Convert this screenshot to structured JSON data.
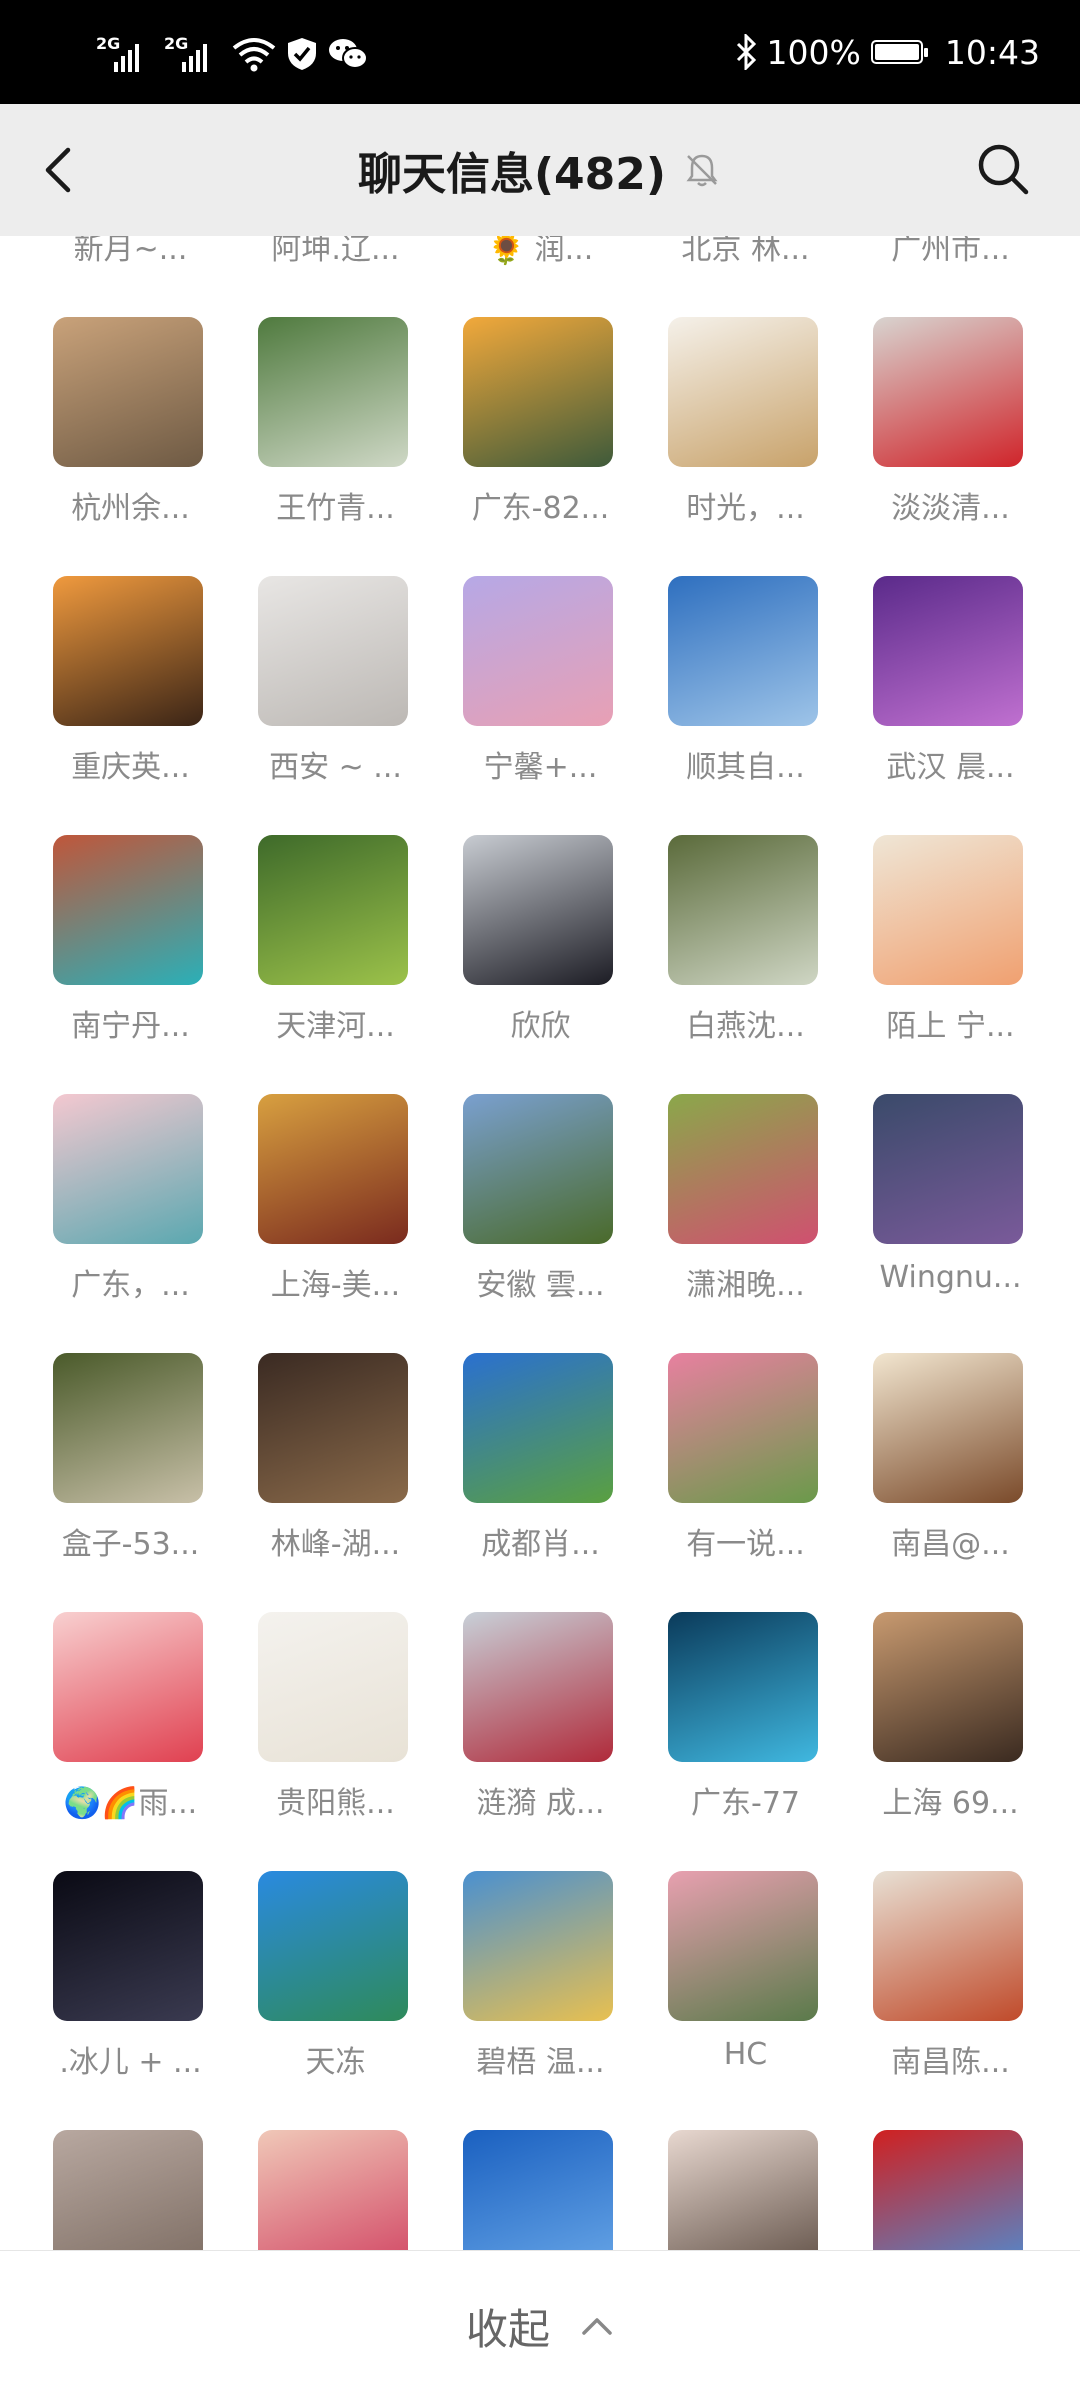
{
  "status_bar": {
    "network_1": "2G",
    "network_2": "2G",
    "battery": "100%",
    "battery_level": 1.0,
    "time": "10:43",
    "icons": [
      "signal-icon",
      "signal-icon",
      "wifi-icon",
      "shield-icon",
      "wechat-icon",
      "bluetooth-icon",
      "battery-icon"
    ]
  },
  "header": {
    "title": "聊天信息(482)",
    "back_icon": "chevron-left-icon",
    "mute_icon": "bell-muted-icon",
    "search_icon": "search-icon"
  },
  "members": [
    {
      "name": "新月~...",
      "colors": [
        "#2c2420",
        "#6b5a4a"
      ]
    },
    {
      "name": "阿坤.辽...",
      "colors": [
        "#3a3632",
        "#8a8076"
      ]
    },
    {
      "name": "🌻 润...",
      "colors": [
        "#6c70c8",
        "#9a9ee0"
      ]
    },
    {
      "name": "北京 林...",
      "colors": [
        "#cfd6de",
        "#8c97a8"
      ]
    },
    {
      "name": "广州市...",
      "colors": [
        "#b02020",
        "#e04a3a"
      ]
    },
    {
      "name": "杭州余...",
      "colors": [
        "#c9a27a",
        "#6e5a44"
      ]
    },
    {
      "name": "王竹青...",
      "colors": [
        "#4f7a3e",
        "#cfd8c6"
      ]
    },
    {
      "name": "广东-82...",
      "colors": [
        "#f2a93b",
        "#3e5a3a"
      ]
    },
    {
      "name": "时光，...",
      "colors": [
        "#f5f1ea",
        "#c8a26a"
      ]
    },
    {
      "name": "淡淡清...",
      "colors": [
        "#d8d4d0",
        "#d0242a"
      ]
    },
    {
      "name": "重庆英...",
      "colors": [
        "#f09a3e",
        "#3a2416"
      ]
    },
    {
      "name": "西安 ~ ...",
      "colors": [
        "#e8e6e4",
        "#bcb8b4"
      ]
    },
    {
      "name": "宁馨+...",
      "colors": [
        "#b6a8e6",
        "#e8a0b4"
      ]
    },
    {
      "name": "顺其自...",
      "colors": [
        "#2e6fbf",
        "#9ec4e8"
      ]
    },
    {
      "name": "武汉 晨...",
      "colors": [
        "#5a2a8a",
        "#c070d0"
      ]
    },
    {
      "name": "南宁丹...",
      "colors": [
        "#c0563a",
        "#2ab0b8"
      ]
    },
    {
      "name": "天津河...",
      "colors": [
        "#3e6a2a",
        "#9cc24a"
      ]
    },
    {
      "name": "欣欣",
      "colors": [
        "#c8ccd2",
        "#1c1c24"
      ]
    },
    {
      "name": "白燕沈...",
      "colors": [
        "#5a6a3a",
        "#cfd6c4"
      ]
    },
    {
      "name": "陌上 宁...",
      "colors": [
        "#efe6d6",
        "#f0a070"
      ]
    },
    {
      "name": "广东，...",
      "colors": [
        "#f4c8d0",
        "#5aa8b0"
      ]
    },
    {
      "name": "上海-美...",
      "colors": [
        "#d8a040",
        "#7a2a1e"
      ]
    },
    {
      "name": "安徽 雲...",
      "colors": [
        "#7aa0d0",
        "#4a6a2a"
      ]
    },
    {
      "name": "潇湘晚...",
      "colors": [
        "#8aa84a",
        "#d05070"
      ]
    },
    {
      "name": "Wingnu...",
      "colors": [
        "#3a4a6a",
        "#7a5a9a"
      ]
    },
    {
      "name": "盒子-53...",
      "colors": [
        "#4a5a2a",
        "#c8c0a8"
      ]
    },
    {
      "name": "林峰-湖...",
      "colors": [
        "#3a2a22",
        "#8a6a4a"
      ]
    },
    {
      "name": "成都肖...",
      "colors": [
        "#2a70d0",
        "#5aa040"
      ]
    },
    {
      "name": "有一说...",
      "colors": [
        "#e880a0",
        "#6a9a4a"
      ]
    },
    {
      "name": "南昌@...",
      "colors": [
        "#f2e6d0",
        "#7a4a2a"
      ]
    },
    {
      "name": "🌍🌈雨...",
      "colors": [
        "#f8d0d0",
        "#e04050"
      ]
    },
    {
      "name": "贵阳熊...",
      "colors": [
        "#f4f2ee",
        "#e8e2d6"
      ]
    },
    {
      "name": "涟漪 成...",
      "colors": [
        "#c8d0d8",
        "#b02a3a"
      ]
    },
    {
      "name": "广东-77",
      "colors": [
        "#0a3a5a",
        "#40b8e0"
      ]
    },
    {
      "name": "上海 69...",
      "colors": [
        "#c89a70",
        "#3a2a20"
      ]
    },
    {
      "name": ".冰儿 + ...",
      "colors": [
        "#0a0a14",
        "#3a3a50"
      ]
    },
    {
      "name": "天冻",
      "colors": [
        "#2a8ae0",
        "#2e8a5a"
      ]
    },
    {
      "name": "碧梧 温...",
      "colors": [
        "#4a90d0",
        "#e8c050"
      ]
    },
    {
      "name": "HC",
      "colors": [
        "#e8a0b0",
        "#5a7a4a"
      ]
    },
    {
      "name": "南昌陈...",
      "colors": [
        "#e8e0d4",
        "#c04a2a"
      ]
    },
    {
      "name": "",
      "colors": [
        "#b8a8a0",
        "#7a6a60"
      ]
    },
    {
      "name": "",
      "colors": [
        "#f0c8b8",
        "#d04060"
      ]
    },
    {
      "name": "",
      "colors": [
        "#1a60c0",
        "#6aa8e8"
      ]
    },
    {
      "name": "",
      "colors": [
        "#e8d8d0",
        "#5a4a40"
      ]
    },
    {
      "name": "",
      "colors": [
        "#d02020",
        "#4a90d8"
      ]
    }
  ],
  "footer": {
    "collapse_label": "收起",
    "collapse_icon": "chevron-up-icon"
  }
}
